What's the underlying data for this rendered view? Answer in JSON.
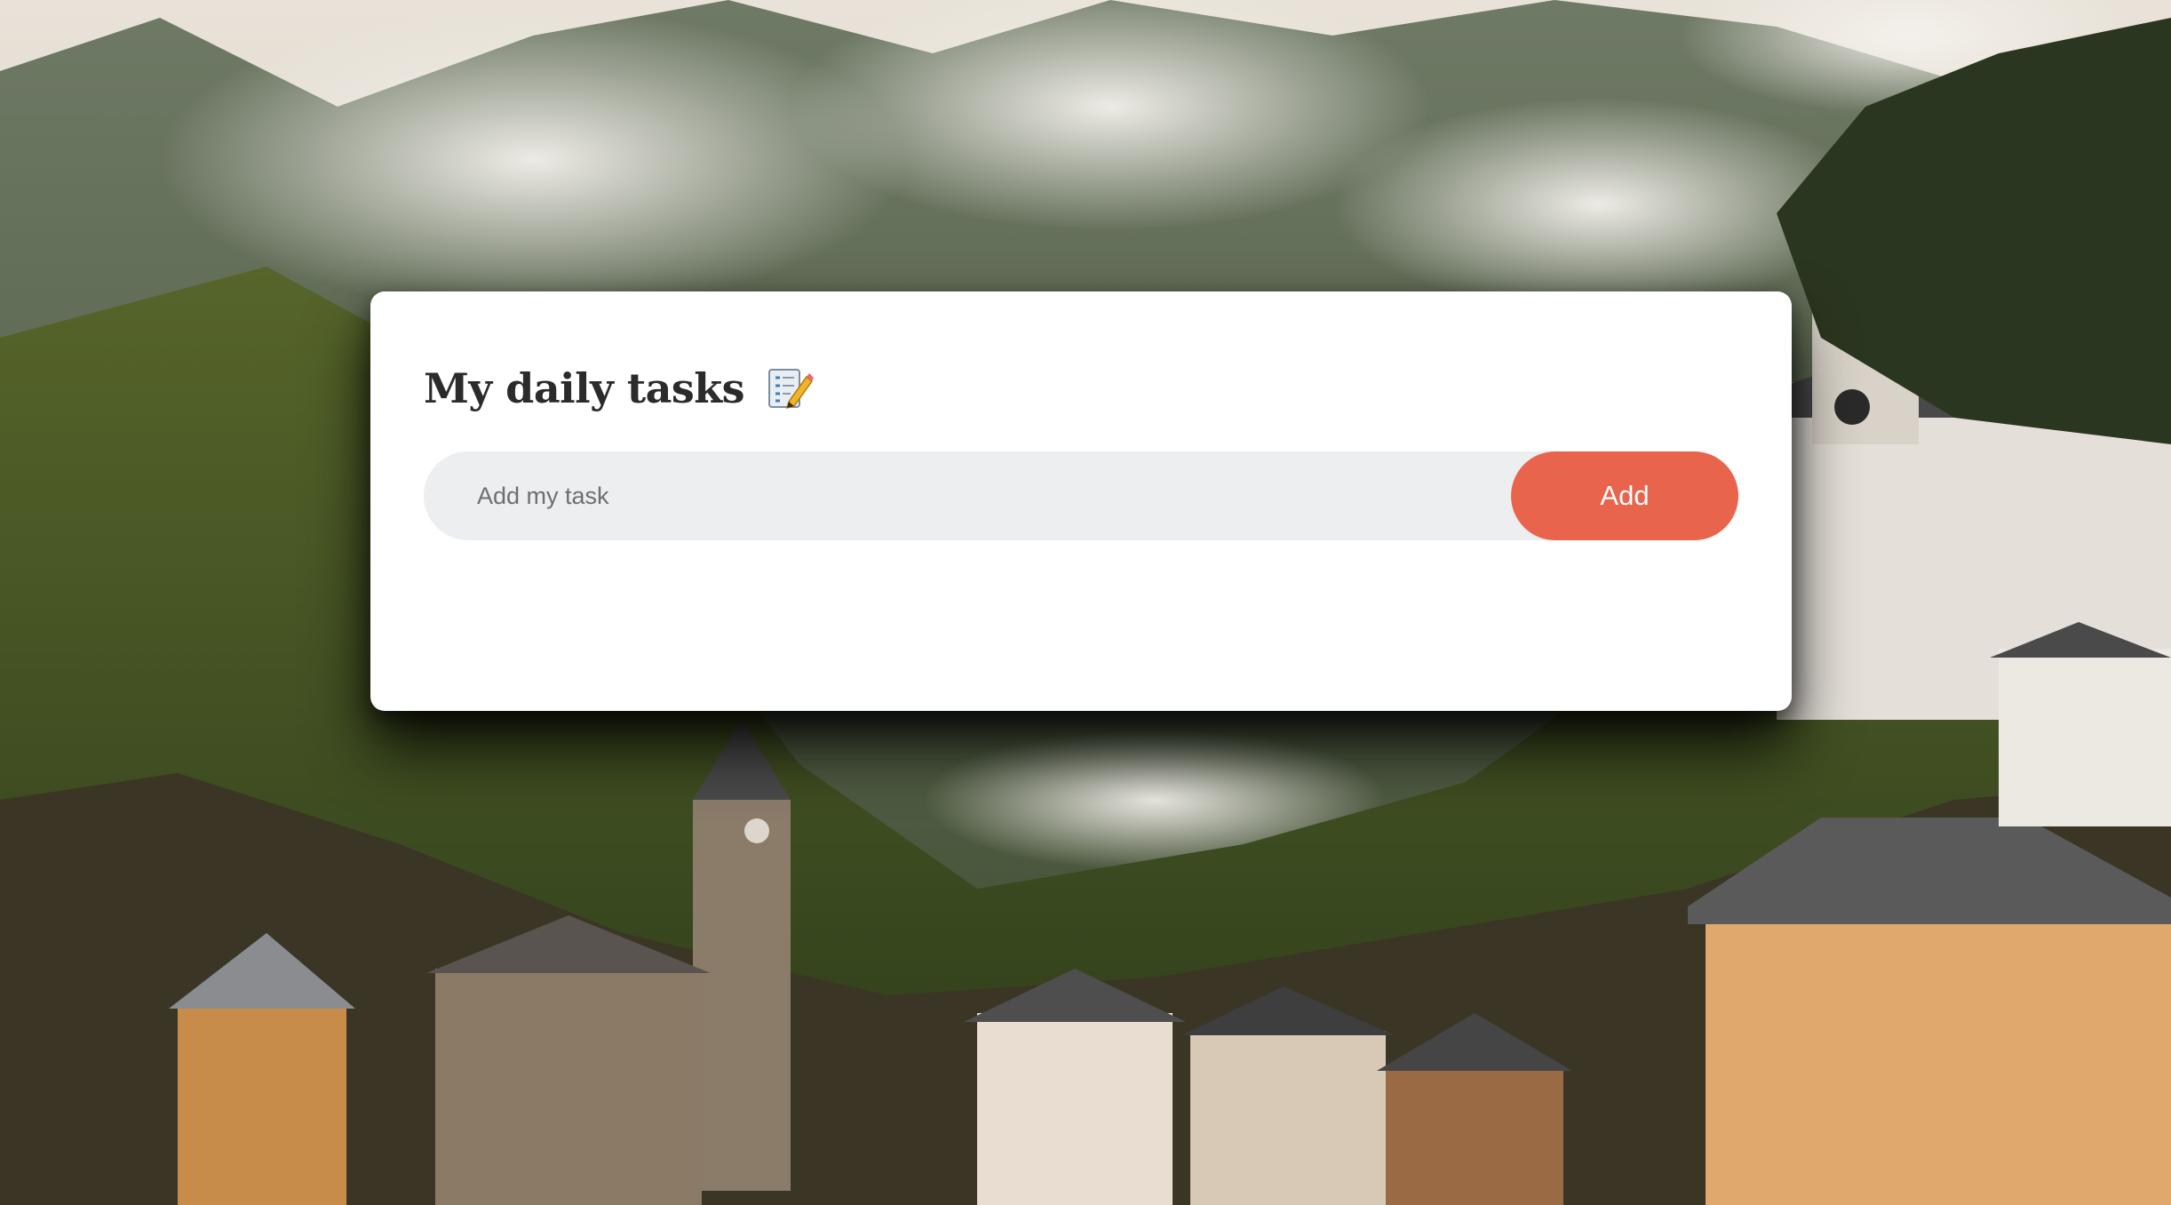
{
  "app": {
    "title": "My daily tasks",
    "title_icon": "memo-icon"
  },
  "task_input": {
    "placeholder": "Add my task",
    "value": ""
  },
  "add_button": {
    "label": "Add"
  },
  "colors": {
    "accent": "#e9644d",
    "input_bg": "#edeef0",
    "card_bg": "#ffffff",
    "title_text": "#2b2b2b"
  }
}
